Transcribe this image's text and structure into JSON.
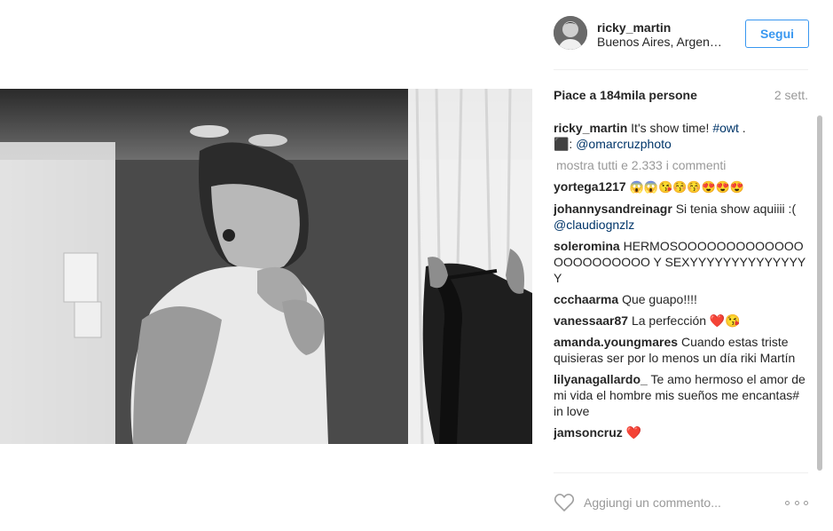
{
  "post": {
    "author": {
      "username": "ricky_martin",
      "location": "Buenos Aires, Argen…"
    },
    "follow_label": "Segui",
    "likes_text": "Piace a 184mila persone",
    "age": "2 sett.",
    "caption": {
      "username": "ricky_martin",
      "text_before": " It's show time! ",
      "hashtag": "#owt",
      "text_after": " .",
      "line2_prefix": "⬛: ",
      "mention": "@omarcruzphoto"
    },
    "load_more": "mostra tutti e 2.333 i commenti",
    "comments": [
      {
        "user": "yortega1217",
        "text": "😱😱😘😚😚😍😍😍"
      },
      {
        "user": "johannysandreinagr",
        "text": "Si tenia show aquiiii :(",
        "mention": "@claudiognzlz"
      },
      {
        "user": "soleromina",
        "text": "HERMOSOOOOOOOOOOOOOOOOOOOOOOO Y SEXYYYYYYYYYYYYYYY"
      },
      {
        "user": "ccchaarma",
        "text": "Que guapo!!!!"
      },
      {
        "user": "vanessaar87",
        "text": "La perfección ❤️😘"
      },
      {
        "user": "amanda.youngmares",
        "text": "Cuando estas triste quisieras ser por lo menos un día riki Martín"
      },
      {
        "user": "lilyanagallardo_",
        "text": "Te amo hermoso el amor de mi vida el hombre mis sueños me encantas# in love"
      },
      {
        "user": "jamsoncruz",
        "text": "❤️"
      }
    ],
    "comment_placeholder": "Aggiungi un commento...",
    "icons": {
      "like": "heart-outline-icon",
      "more": "more-options-icon",
      "avatar": "profile-avatar"
    },
    "colors": {
      "accent": "#3897f0",
      "link": "#003569",
      "muted": "#999999",
      "text": "#262626"
    }
  }
}
